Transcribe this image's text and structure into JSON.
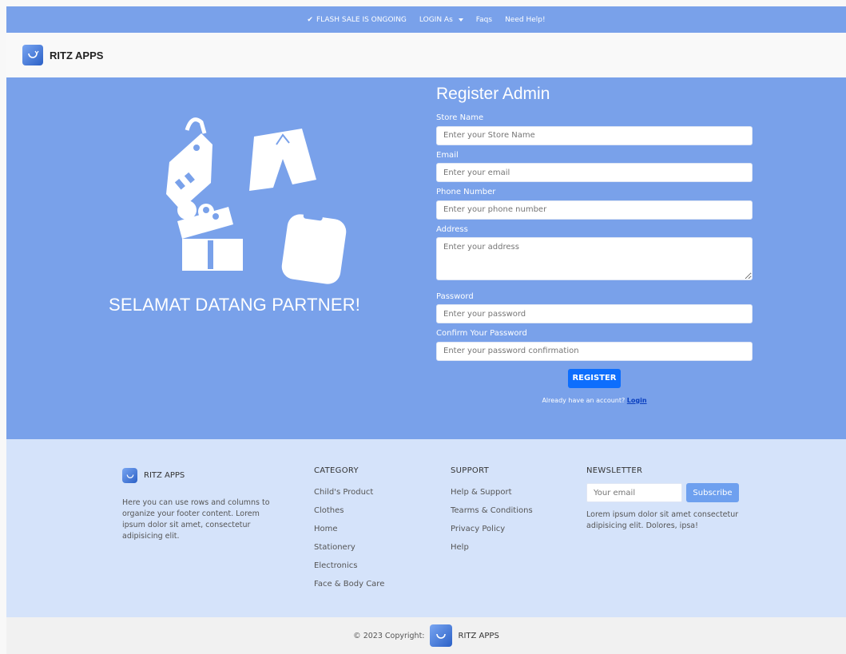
{
  "topbar": {
    "flash_check": "✔",
    "flash_sale": "FLASH SALE IS ONGOING",
    "login_as": "LOGIN As",
    "faqs": "Faqs",
    "need_help": "Need Help!"
  },
  "navbar": {
    "brand": "RITZ APPS"
  },
  "hero": {
    "welcome": "SELAMAT DATANG PARTNER!"
  },
  "form": {
    "title": "Register Admin",
    "store_name_label": "Store Name",
    "store_name_placeholder": "Enter your Store Name",
    "email_label": "Email",
    "email_placeholder": "Enter your email",
    "phone_label": "Phone Number",
    "phone_placeholder": "Enter your phone number",
    "address_label": "Address",
    "address_placeholder": "Enter your address",
    "password_label": "Password",
    "password_placeholder": "Enter your password",
    "confirm_label": "Confirm Your Password",
    "confirm_placeholder": "Enter your password confirmation",
    "register_button": "REGISTER",
    "already_text": "Already have an account?",
    "login_link": "Login"
  },
  "footer": {
    "brand": "RITZ APPS",
    "description": "Here you can use rows and columns to organize your footer content. Lorem ipsum dolor sit amet, consectetur adipisicing elit.",
    "category": {
      "title": "CATEGORY",
      "items": [
        "Child's Product",
        "Clothes",
        "Home",
        "Stationery",
        "Electronics",
        "Face & Body Care"
      ]
    },
    "support": {
      "title": "SUPPORT",
      "items": [
        "Help & Support",
        "Tearms & Conditions",
        "Privacy Policy",
        "Help"
      ]
    },
    "newsletter": {
      "title": "NEWSLETTER",
      "email_placeholder": "Your email",
      "subscribe_button": "Subscribe",
      "description": "Lorem ipsum dolor sit amet consectetur adipisicing elit. Dolores, ipsa!"
    }
  },
  "bottombar": {
    "copyright": "© 2023 Copyright:",
    "brand": "RITZ APPS"
  },
  "colors": {
    "primary_blue": "#79a1ea",
    "button_blue": "#0d6efd",
    "footer_bg": "#d5e3fa"
  }
}
